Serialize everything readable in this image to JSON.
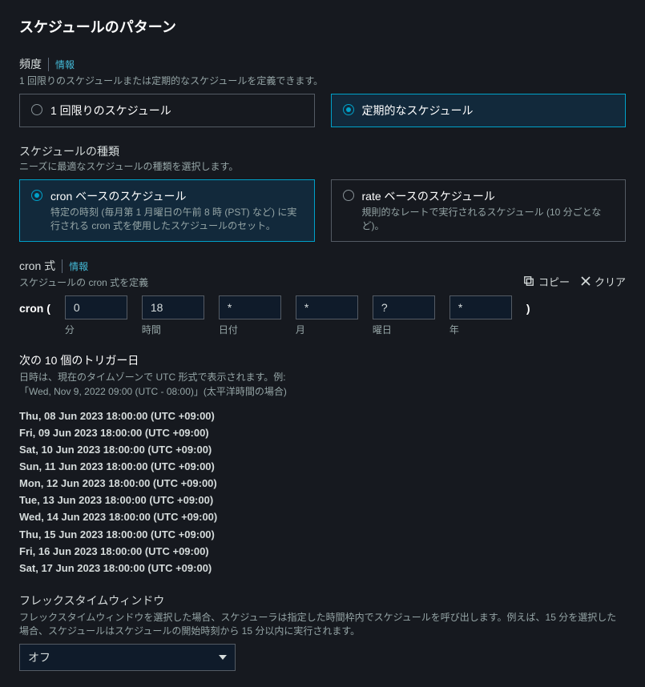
{
  "panel": {
    "title": "スケジュールのパターン"
  },
  "frequency": {
    "label": "頻度",
    "info": "情報",
    "desc": "1 回限りのスケジュールまたは定期的なスケジュールを定義できます。",
    "options": {
      "once": "1 回限りのスケジュール",
      "recurring": "定期的なスケジュール"
    }
  },
  "scheduleType": {
    "label": "スケジュールの種類",
    "desc": "ニーズに最適なスケジュールの種類を選択します。",
    "cron": {
      "title": "cron ベースのスケジュール",
      "sub": "特定の時刻 (毎月第 1 月曜日の午前 8 時 (PST) など) に実行される cron 式を使用したスケジュールのセット。"
    },
    "rate": {
      "title": "rate ベースのスケジュール",
      "sub": "規則的なレートで実行されるスケジュール (10 分ごとなど)。"
    }
  },
  "cronExpr": {
    "label": "cron 式",
    "info": "情報",
    "desc": "スケジュールの cron 式を定義",
    "copy": "コピー",
    "clear": "クリア",
    "prefix": "cron (",
    "suffix": ")",
    "fields": [
      {
        "value": "0",
        "label": "分"
      },
      {
        "value": "18",
        "label": "時間"
      },
      {
        "value": "*",
        "label": "日付"
      },
      {
        "value": "*",
        "label": "月"
      },
      {
        "value": "?",
        "label": "曜日"
      },
      {
        "value": "*",
        "label": "年"
      }
    ]
  },
  "triggers": {
    "title": "次の 10 個のトリガー日",
    "desc1": "日時は、現在のタイムゾーンで UTC 形式で表示されます。例:",
    "desc2": "「Wed, Nov 9, 2022 09:00 (UTC - 08:00)」(太平洋時間の場合)",
    "items": [
      "Thu, 08 Jun 2023 18:00:00 (UTC +09:00)",
      "Fri, 09 Jun 2023 18:00:00 (UTC +09:00)",
      "Sat, 10 Jun 2023 18:00:00 (UTC +09:00)",
      "Sun, 11 Jun 2023 18:00:00 (UTC +09:00)",
      "Mon, 12 Jun 2023 18:00:00 (UTC +09:00)",
      "Tue, 13 Jun 2023 18:00:00 (UTC +09:00)",
      "Wed, 14 Jun 2023 18:00:00 (UTC +09:00)",
      "Thu, 15 Jun 2023 18:00:00 (UTC +09:00)",
      "Fri, 16 Jun 2023 18:00:00 (UTC +09:00)",
      "Sat, 17 Jun 2023 18:00:00 (UTC +09:00)"
    ]
  },
  "flexWindow": {
    "label": "フレックスタイムウィンドウ",
    "desc": "フレックスタイムウィンドウを選択した場合、スケジューラは指定した時間枠内でスケジュールを呼び出します。例えば、15 分を選択した場合、スケジュールはスケジュールの開始時刻から 15 分以内に実行されます。",
    "value": "オフ"
  }
}
